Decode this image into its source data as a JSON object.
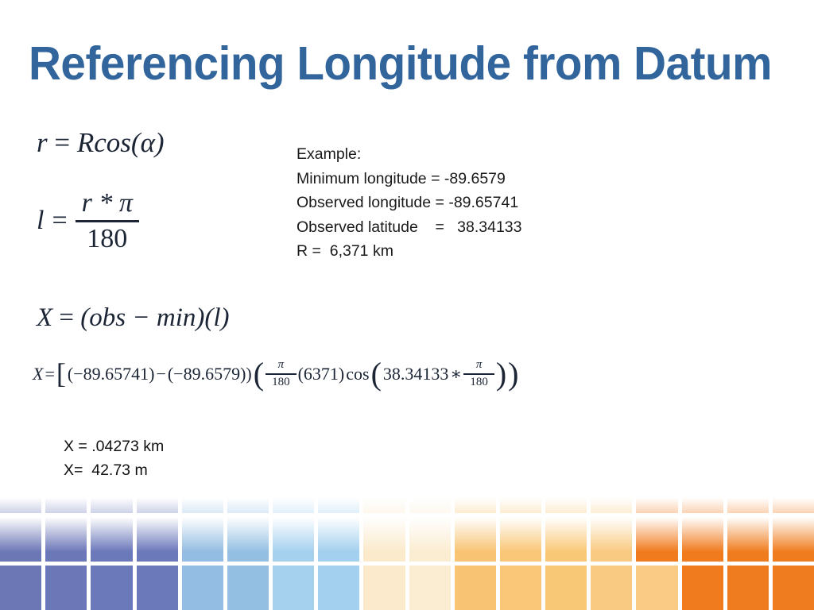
{
  "slide": {
    "title": "Referencing Longitude from Datum",
    "title_color": "#31659C",
    "background": "#ffffff"
  },
  "equations": {
    "eq_r": {
      "label": "r-equals-R-cos-alpha",
      "lhs": "r",
      "rel": "=",
      "rhs": "Rcos(α)",
      "plain": "r = Rcos(α)"
    },
    "eq_l": {
      "label": "l-equals-r-pi-over-180",
      "lhs": "l",
      "rel": "=",
      "numerator": "r * π",
      "denominator": "180",
      "plain": "l = (r * π) / 180"
    },
    "eq_x": {
      "label": "X-equals-obs-minus-min-times-l",
      "plain": "X = (obs − min)(l)",
      "lhs": "X",
      "rel": "=",
      "rhs": "(obs − min)(l)"
    },
    "eq_x_full": {
      "label": "X-expanded-numeric",
      "lhs": "X",
      "rel": "=",
      "open_bracket": "[",
      "term1": "(−89.65741)",
      "minus": "−",
      "term2": "(−89.6579))",
      "open_paren": "(",
      "frac1_num": "π",
      "frac1_den": "180",
      "radius": "(6371)",
      "cos": "cos",
      "cos_open": "(",
      "latitude": "38.34133",
      "times": "∗",
      "frac2_num": "π",
      "frac2_den": "180",
      "cos_close": ")",
      "close_paren": ")",
      "plain": "X = [(−89.65741) − (−89.6579)) (π/180 (6371) cos(38.34133 ∗ π/180))"
    }
  },
  "example": {
    "heading": "Example:",
    "lines": [
      "Example:",
      "Minimum longitude = -89.6579",
      "Observed longitude = -89.65741",
      "Observed latitude    =   38.34133",
      "R =  6,371 km"
    ],
    "text": "Example:\nMinimum longitude = -89.6579\nObserved longitude = -89.65741\nObserved latitude    =   38.34133\nR =  6,371 km",
    "minimum_longitude": "-89.6579",
    "observed_longitude": "-89.65741",
    "observed_latitude": "38.34133",
    "radius": "6,371 km"
  },
  "results": {
    "lines": [
      "X = .04273 km",
      "X=  42.73 m"
    ],
    "text": "X = .04273 km\nX=  42.73 m",
    "km_value": ".04273 km",
    "m_value": "42.73 m"
  },
  "color_band": {
    "columns": 18,
    "rows": 3,
    "colors": [
      "#6C77B6",
      "#6C77B8",
      "#6B78BA",
      "#6B78BA",
      "#93BDE2",
      "#93BFE3",
      "#A5D1EE",
      "#A3D0EE",
      "#FBEACB",
      "#FBEDD2",
      "#F8C473",
      "#F9C777",
      "#F9C877",
      "#F9CA81",
      "#F07B1F",
      "#F07B1F",
      "#F07C20",
      "#F07C20"
    ],
    "row3_last_overrides": {
      "14": "#FACB84"
    }
  }
}
